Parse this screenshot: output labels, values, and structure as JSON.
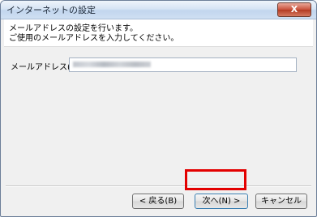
{
  "window": {
    "title": "インターネットの設定",
    "close_label": "X"
  },
  "header": {
    "instruction": "メールアドレスの設定を行います。\nご使用のメールアドレスを入力してください。"
  },
  "form": {
    "email_label": "メールアドレス(M) :",
    "email_value_note": "blurred"
  },
  "buttons": {
    "back_label": "< 戻る(B)",
    "next_label": "次へ(N) >",
    "cancel_label": "キャンセル"
  },
  "colors": {
    "highlight": "#e30000"
  }
}
